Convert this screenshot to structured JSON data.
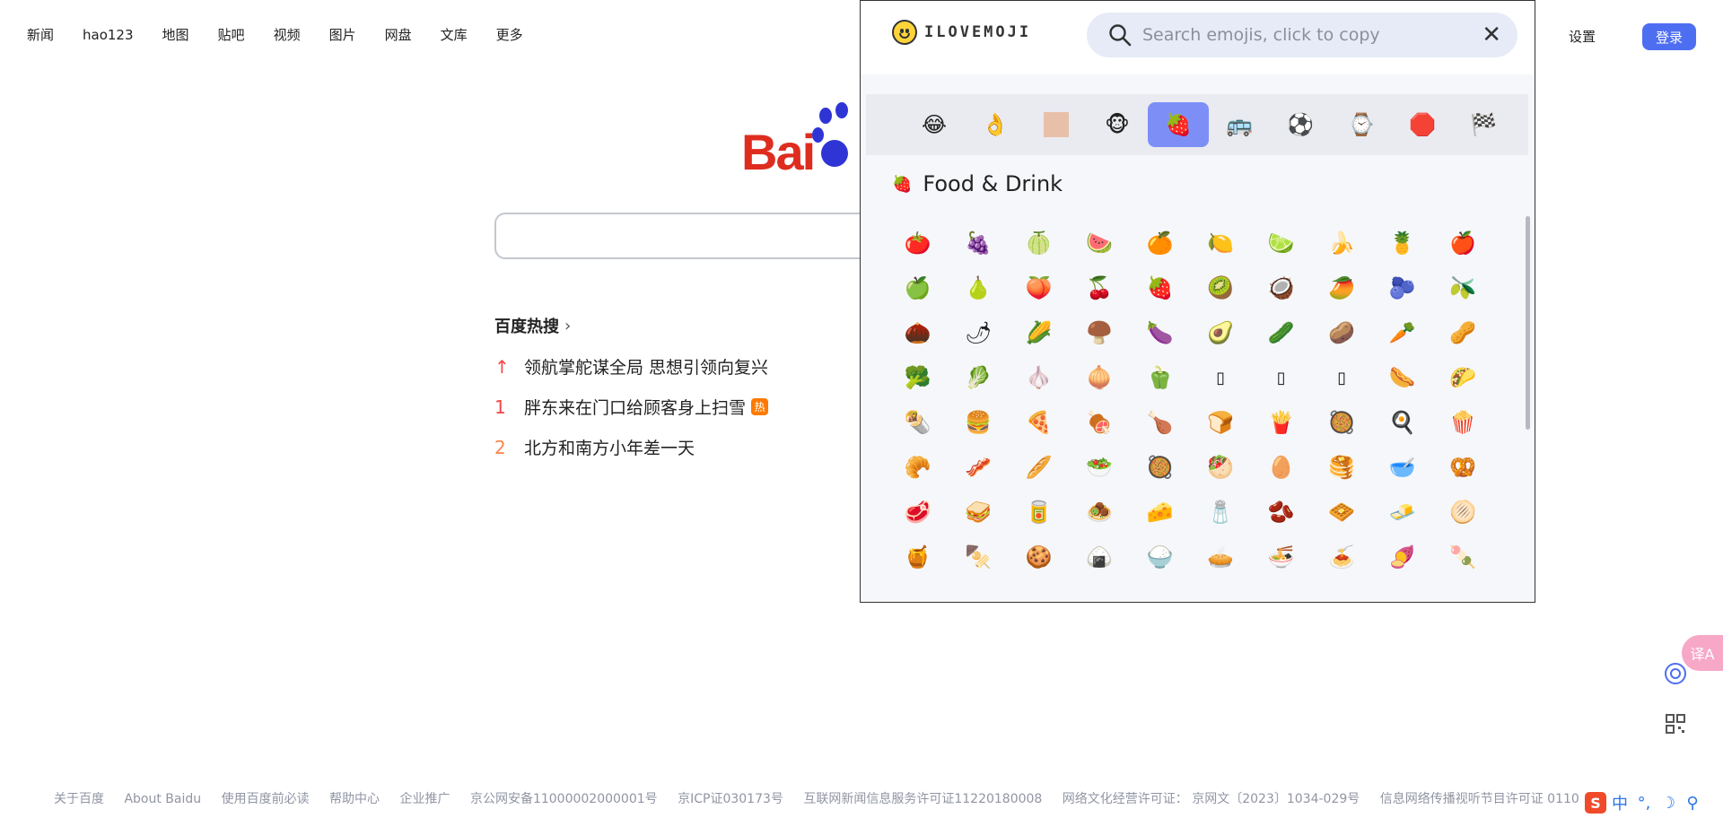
{
  "top_nav": [
    "新闻",
    "hao123",
    "地图",
    "贴吧",
    "视频",
    "图片",
    "网盘",
    "文库",
    "更多"
  ],
  "top_right": {
    "settings": "设置",
    "login": "登录"
  },
  "logo_text": "Bai",
  "hot": {
    "title": "百度热搜",
    "items": [
      {
        "rank": "↑",
        "text": "领航掌舵谋全局 思想引领向复兴"
      },
      {
        "rank": "1",
        "text": "胖东来在门口给顾客身上扫雪",
        "badge": "热"
      },
      {
        "rank": "2",
        "text": "北方和南方小年差一天"
      }
    ]
  },
  "footer": [
    "关于百度",
    "About Baidu",
    "使用百度前必读",
    "帮助中心",
    "企业推广",
    "京公网安备11000002000001号",
    "京ICP证030173号",
    "互联网新闻信息服务许可证11220180008",
    "网络文化经营许可证： 京网文〔2023〕1034-029号",
    "信息网络传播视听节目许可证 0110516"
  ],
  "ime": {
    "logo": "S",
    "chars": [
      "中",
      "°,",
      "☽",
      "⚲"
    ]
  },
  "translate_label": "译A",
  "emoji_app": {
    "brand": "ILOVEMOJI",
    "search_placeholder": "Search emojis, click to copy",
    "categories": [
      "😂",
      "👌",
      "",
      "🐵",
      "🍓",
      "🚌",
      "⚽",
      "⌚",
      "🛑",
      "🏁"
    ],
    "active_category_index": 4,
    "section_icon": "🍓",
    "section_title": "Food & Drink",
    "emojis": [
      "🍅",
      "🍇",
      "🍈",
      "🍉",
      "🍊",
      "🍋",
      "🍋‍🟩",
      "🍌",
      "🍍",
      "🍎",
      "🍏",
      "🍐",
      "🍑",
      "🍒",
      "🍓",
      "🥝",
      "🥥",
      "🥭",
      "🫐",
      "🫒",
      "🌰",
      "🌶",
      "🌽",
      "🍄‍🟫",
      "🍆",
      "🥑",
      "🥒",
      "🥔",
      "🥕",
      "🥜",
      "🥦",
      "🥬",
      "🧄",
      "🧅",
      "🫑",
      "▯",
      "▯",
      "▯",
      "🌭",
      "🌮",
      "🌯",
      "🍔",
      "🍕",
      "🍖",
      "🍗",
      "🍞",
      "🍟",
      "🥘",
      "🍳",
      "🍿",
      "🥐",
      "🥓",
      "🥖",
      "🥗",
      "🥘",
      "🥙",
      "🥚",
      "🥞",
      "🥣",
      "🥨",
      "🥩",
      "🥪",
      "🥫",
      "🧆",
      "🧀",
      "🧂",
      "🫘",
      "🧇",
      "🧈",
      "🫓",
      "🍯",
      "🍢",
      "🍪",
      "🍙",
      "🍚",
      "🥧",
      "🍜",
      "🍝",
      "🍠",
      "🍡"
    ]
  }
}
